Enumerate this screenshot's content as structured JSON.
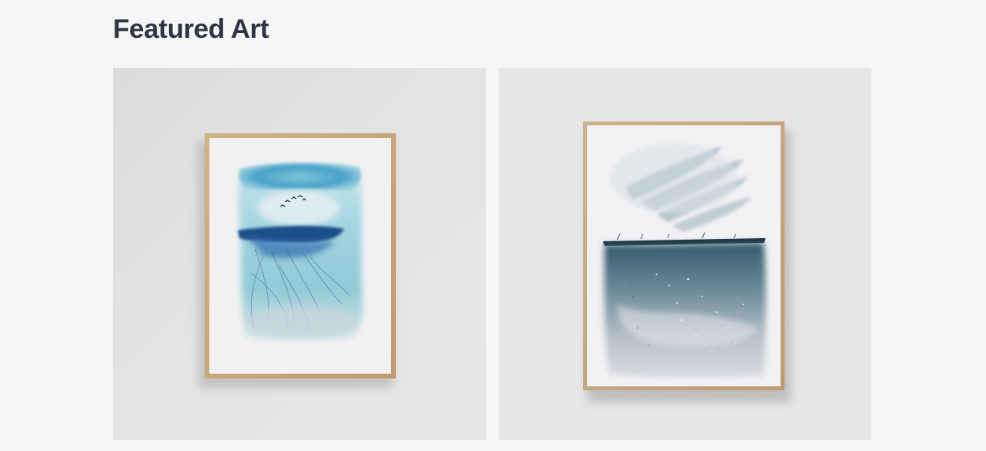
{
  "section": {
    "title": "Featured Art"
  },
  "artworks": [
    {
      "name": "blue-watercolor-seascape-with-birds",
      "wall_color": "#e2e2e3",
      "frame_color": "#c9a57c",
      "accent": "#2f6fa8"
    },
    {
      "name": "grey-teal-watercolor-seascape",
      "wall_color": "#ececec",
      "frame_color": "#c6a47c",
      "accent": "#3b5f73"
    }
  ]
}
